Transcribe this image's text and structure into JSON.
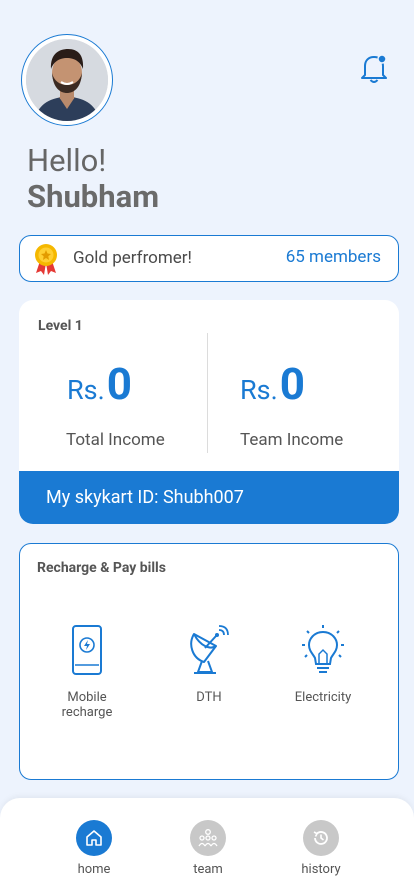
{
  "header": {
    "greeting": "Hello!",
    "user_name": "Shubham"
  },
  "gold": {
    "label": "Gold perfromer!",
    "members": "65 members"
  },
  "income": {
    "level": "Level 1",
    "currency": "Rs.",
    "total_value": "0",
    "total_label": "Total Income",
    "team_value": "0",
    "team_label": "Team Income",
    "id_text": "My skykart ID: Shubh007"
  },
  "recharge": {
    "title": "Recharge & Pay bills",
    "services": [
      {
        "label": "Mobile recharge",
        "icon": "mobile-recharge-icon"
      },
      {
        "label": "DTH",
        "icon": "satellite-dish-icon"
      },
      {
        "label": "Electricity",
        "icon": "lightbulb-icon"
      }
    ]
  },
  "nav": {
    "items": [
      {
        "label": "home",
        "icon": "home-icon"
      },
      {
        "label": "team",
        "icon": "team-icon"
      },
      {
        "label": "history",
        "icon": "history-icon"
      }
    ]
  },
  "colors": {
    "accent": "#1a7ad3",
    "background": "#edf3fd",
    "inactive_nav": "#c8c8c8"
  }
}
